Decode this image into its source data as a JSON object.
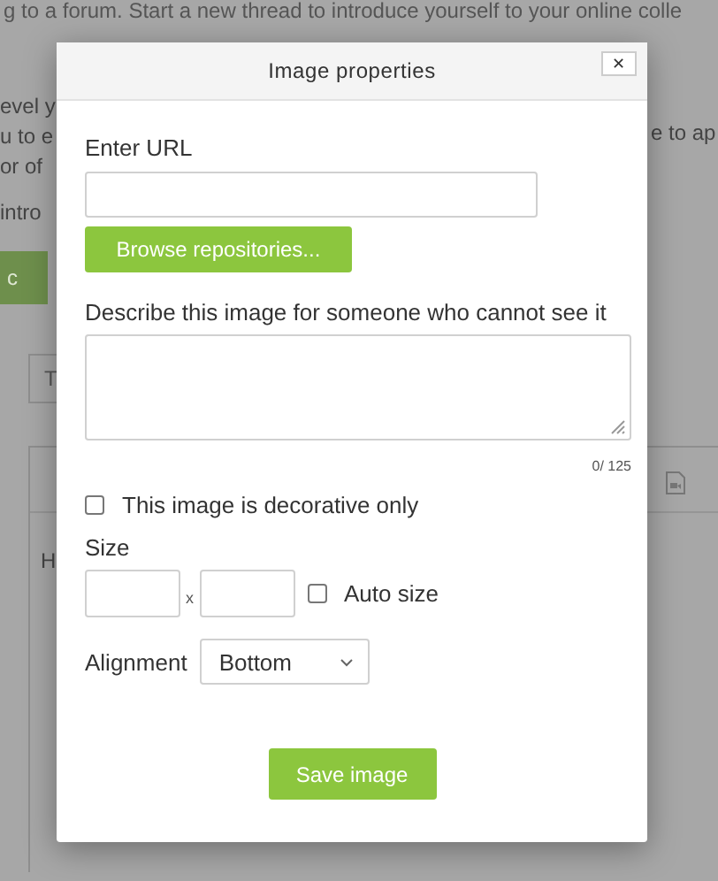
{
  "page": {
    "intro_line": "g to a forum. Start a new thread to introduce yourself to your online colle",
    "left_snippets": [
      "evel y",
      "u to e",
      "or of",
      "intro"
    ],
    "right_snippet": "e to ap",
    "button": "c",
    "field_value": "T",
    "editor_text": "H"
  },
  "dialog": {
    "title": "Image properties",
    "close": "✕",
    "url_label": "Enter URL",
    "browse_button": "Browse repositories...",
    "alt_label": "Describe this image for someone who cannot see it",
    "char_count": "0/ 125",
    "decorative": {
      "label": "This image is decorative only",
      "checked": false
    },
    "size_label": "Size",
    "size_separator": "x",
    "auto_size": {
      "label": "Auto size",
      "checked": false
    },
    "alignment_label": "Alignment",
    "alignment_value": "Bottom",
    "save_button": "Save image"
  }
}
